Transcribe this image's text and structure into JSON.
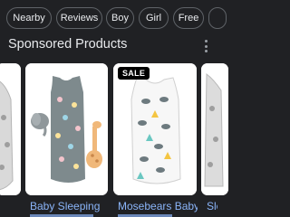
{
  "filter_chips": [
    "Nearby",
    "Reviews",
    "Boy",
    "Girl",
    "Free"
  ],
  "section": {
    "title": "Sponsored Products"
  },
  "products": [
    {
      "title": "",
      "badge": ""
    },
    {
      "title": "Baby Sleeping",
      "badge": ""
    },
    {
      "title": "Mosebears Baby",
      "badge": "SALE"
    },
    {
      "title": "Sle",
      "badge": ""
    }
  ],
  "colors": {
    "background": "#202124",
    "chip_border": "#5f6368",
    "text": "#e8eaed",
    "link": "#8ab4f8",
    "card": "#ffffff"
  },
  "icons": {
    "menu": "more-vert-icon"
  }
}
